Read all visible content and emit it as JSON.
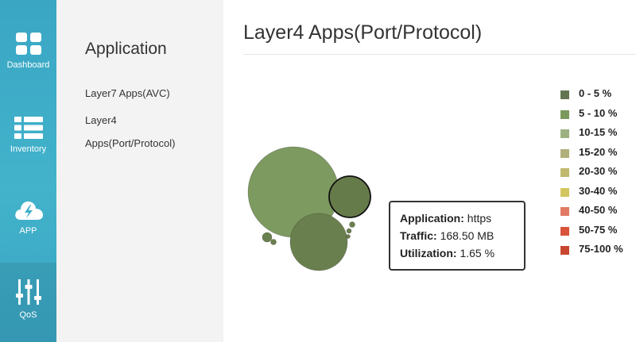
{
  "nav": {
    "items": [
      {
        "label": "Dashboard",
        "icon": "dashboard-grid-icon"
      },
      {
        "label": "Inventory",
        "icon": "list-icon"
      },
      {
        "label": "APP",
        "icon": "cloud-bolt-icon"
      },
      {
        "label": "QoS",
        "icon": "sliders-icon"
      }
    ]
  },
  "submenu": {
    "title": "Application",
    "links": [
      "Layer7 Apps(AVC)",
      "Layer4",
      "Apps(Port/Protocol)"
    ]
  },
  "page": {
    "title": "Layer4 Apps(Port/Protocol)"
  },
  "tooltip": {
    "application_label": "Application:",
    "application_value": "https",
    "traffic_label": "Traffic:",
    "traffic_value": "168.50 MB",
    "utilization_label": "Utilization:",
    "utilization_value": "1.65 %"
  },
  "legend": [
    {
      "label": "0 - 5 %",
      "color": "#637550"
    },
    {
      "label": "5 - 10 %",
      "color": "#7a9a5e"
    },
    {
      "label": "10-15 %",
      "color": "#9db282"
    },
    {
      "label": "15-20 %",
      "color": "#b1b07a"
    },
    {
      "label": "20-30 %",
      "color": "#c0b96e"
    },
    {
      "label": "30-40 %",
      "color": "#d3c65e"
    },
    {
      "label": "40-50 %",
      "color": "#e07a62"
    },
    {
      "label": "50-75 %",
      "color": "#d9533a"
    },
    {
      "label": "75-100 %",
      "color": "#c84730"
    }
  ],
  "bubbles": [
    {
      "relative_size": 1.0,
      "color": "#7d9a60",
      "highlighted": false
    },
    {
      "relative_size": 0.63,
      "color": "#6a7f4e",
      "highlighted": false
    },
    {
      "relative_size": 0.46,
      "color": "#667b4a",
      "highlighted": true
    },
    {
      "relative_size": 0.1,
      "color": "#6a7f4e",
      "highlighted": false
    },
    {
      "relative_size": 0.06,
      "color": "#6a7f4e",
      "highlighted": false
    },
    {
      "relative_size": 0.06,
      "color": "#6a7f4e",
      "highlighted": false
    },
    {
      "relative_size": 0.05,
      "color": "#6a7f4e",
      "highlighted": false
    },
    {
      "relative_size": 0.04,
      "color": "#6a7f4e",
      "highlighted": false
    }
  ]
}
